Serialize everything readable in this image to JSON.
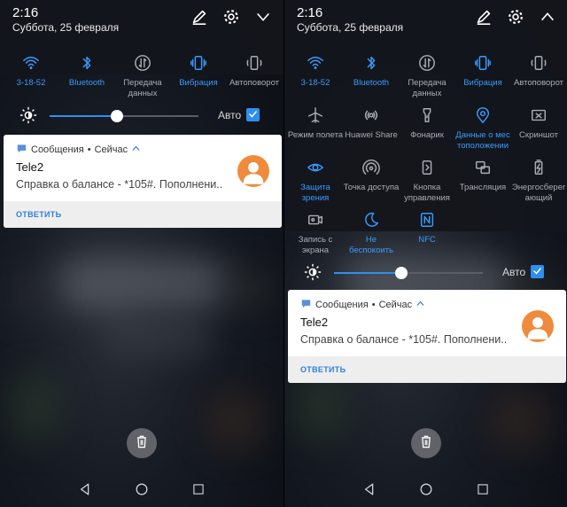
{
  "status": {
    "time": "2:16",
    "date": "Суббота, 25 февраля"
  },
  "colors": {
    "accent": "#2f8ff0",
    "avatar": "#f08a3c",
    "tile_off": "#a9adb4",
    "tile_on": "#3a9bff"
  },
  "left": {
    "tiles": [
      {
        "label": "3-18-52",
        "icon": "wifi-icon",
        "on": true
      },
      {
        "label": "Bluetooth",
        "icon": "bluetooth-icon",
        "on": true
      },
      {
        "label": "Передача данных",
        "icon": "data-transfer-icon",
        "on": false
      },
      {
        "label": "Вибрация",
        "icon": "vibration-icon",
        "on": true
      },
      {
        "label": "Автоповорот",
        "icon": "autorotate-icon",
        "on": false
      }
    ]
  },
  "right": {
    "tiles": [
      {
        "label": "3-18-52",
        "icon": "wifi-icon",
        "on": true
      },
      {
        "label": "Bluetooth",
        "icon": "bluetooth-icon",
        "on": true
      },
      {
        "label": "Передача данных",
        "icon": "data-transfer-icon",
        "on": false
      },
      {
        "label": "Вибрация",
        "icon": "vibration-icon",
        "on": true
      },
      {
        "label": "Автоповорот",
        "icon": "autorotate-icon",
        "on": false
      },
      {
        "label": "Режим полета",
        "icon": "airplane-icon",
        "on": false
      },
      {
        "label": "Huawei Share",
        "icon": "huawei-share-icon",
        "on": false
      },
      {
        "label": "Фонарик",
        "icon": "flashlight-icon",
        "on": false
      },
      {
        "label": "Данные о мес тоположении",
        "icon": "location-icon",
        "on": true
      },
      {
        "label": "Скриншот",
        "icon": "screenshot-icon",
        "on": false
      },
      {
        "label": "Защита зрения",
        "icon": "eye-icon",
        "on": true
      },
      {
        "label": "Точка доступа",
        "icon": "hotspot-icon",
        "on": false
      },
      {
        "label": "Кнопка управления",
        "icon": "control-button-icon",
        "on": false
      },
      {
        "label": "Трансляция",
        "icon": "cast-icon",
        "on": false
      },
      {
        "label": "Энергосбереr ающий",
        "icon": "battery-saver-icon",
        "on": false
      },
      {
        "label": "Запись с экрана",
        "icon": "screen-record-icon",
        "on": false
      },
      {
        "label": "Не беспокоить",
        "icon": "moon-icon",
        "on": true
      },
      {
        "label": "NFC",
        "icon": "nfc-icon",
        "on": true
      }
    ]
  },
  "brightness": {
    "auto_label": "Авто",
    "auto_checked": true,
    "level": 0.45
  },
  "notification": {
    "app": "Сообщения",
    "separator": "•",
    "when": "Сейчас",
    "title": "Tele2",
    "body": "Справка о балансе - *105#. Пополнени..",
    "action": "ОТВЕТИТЬ"
  }
}
